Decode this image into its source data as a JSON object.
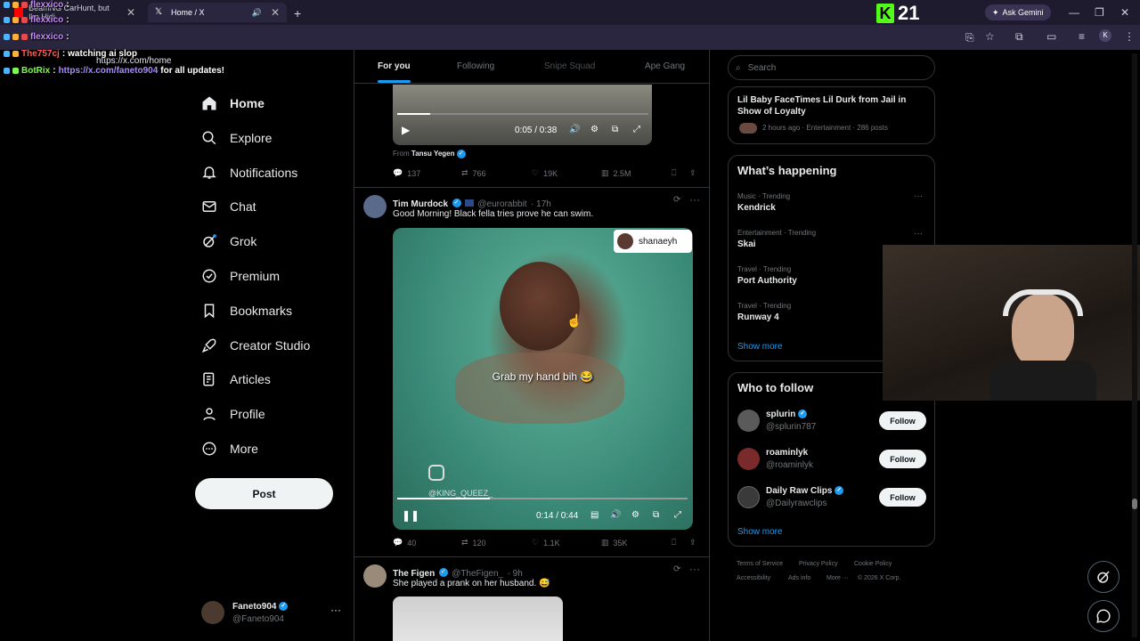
{
  "browser": {
    "tabs": [
      {
        "label": "BeamNG CarHunt, but I'm Hidi"
      },
      {
        "label": "Home / X"
      }
    ],
    "url": "https://x.com/home",
    "gemini_label": "Ask Gemini",
    "profile_initial": "K"
  },
  "stream": {
    "kick_count": "21",
    "chat": [
      {
        "user": "flexxico",
        "message": "",
        "color": "#c58af9"
      },
      {
        "user": "flexxico",
        "message": "",
        "color": "#c58af9"
      },
      {
        "user": "flexxico",
        "message": "",
        "color": "#c58af9"
      },
      {
        "user": "The757cj",
        "message": "watching ai slop",
        "color": "#ff5d5d"
      },
      {
        "user": "BotRix",
        "message": "https://x.com/faneto904",
        "suffix": "for all updates!",
        "color": "#7cfc4a"
      }
    ]
  },
  "nav": {
    "items": [
      {
        "label": "Home",
        "icon": "home-icon"
      },
      {
        "label": "Explore",
        "icon": "search-icon"
      },
      {
        "label": "Notifications",
        "icon": "bell-icon"
      },
      {
        "label": "Chat",
        "icon": "mail-icon"
      },
      {
        "label": "Grok",
        "icon": "grok-icon"
      },
      {
        "label": "Premium",
        "icon": "premium-icon"
      },
      {
        "label": "Bookmarks",
        "icon": "bookmark-icon"
      },
      {
        "label": "Creator Studio",
        "icon": "rocket-icon"
      },
      {
        "label": "Articles",
        "icon": "article-icon"
      },
      {
        "label": "Profile",
        "icon": "profile-icon"
      },
      {
        "label": "More",
        "icon": "more-icon"
      }
    ],
    "post_label": "Post",
    "account": {
      "name": "Faneto904",
      "handle": "@Faneto904"
    }
  },
  "timeline": {
    "tabs": [
      "For you",
      "Following",
      "Snipe Squad",
      "Ape Gang"
    ],
    "prev_tweet": {
      "video_time": "0:05 / 0:38",
      "from_label": "From",
      "from_name": "Tansu Yegen",
      "replies": "137",
      "reposts": "766",
      "likes": "19K",
      "views": "2.5M"
    },
    "tweet1": {
      "name": "Tim Murdock",
      "handle": "@eurorabbit",
      "time": "· 17h",
      "text": "Good Morning! Black fella tries prove he can swim.",
      "video_badge": "shanaeyh",
      "caption": "Grab my hand bih 😂",
      "watermark": "@KING_QUEEZ_",
      "video_time": "0:14 / 0:44",
      "replies": "40",
      "reposts": "120",
      "likes": "1.1K",
      "views": "35K"
    },
    "tweet2": {
      "name": "The Figen",
      "handle": "@TheFigen_",
      "time": "· 9h",
      "text": "She played a prank on her husband. 😅"
    }
  },
  "sidebar": {
    "search_placeholder": "Search",
    "news": {
      "title": "Lil Baby FaceTimes Lil Durk from Jail in Show of Loyalty",
      "meta": "2 hours ago · Entertainment · 286 posts"
    },
    "whats_happening": {
      "title": "What’s happening",
      "trends": [
        {
          "meta": "Music · Trending",
          "name": "Kendrick"
        },
        {
          "meta": "Entertainment · Trending",
          "name": "Skai"
        },
        {
          "meta": "Travel · Trending",
          "name": "Port Authority"
        },
        {
          "meta": "Travel · Trending",
          "name": "Runway 4"
        }
      ],
      "show_more": "Show more"
    },
    "who_to_follow": {
      "title": "Who to follow",
      "users": [
        {
          "name": "splurin",
          "handle": "@splurin787",
          "verified": true
        },
        {
          "name": "roaminlyk",
          "handle": "@roaminlyk",
          "verified": false
        },
        {
          "name": "Daily Raw Clips",
          "handle": "@Dailyrawclips",
          "verified": true
        }
      ],
      "follow_label": "Follow",
      "show_more": "Show more"
    },
    "footer": [
      "Terms of Service",
      "Privacy Policy",
      "Cookie Policy",
      "Accessibility",
      "Ads info",
      "More ···",
      "© 2026 X Corp."
    ]
  }
}
